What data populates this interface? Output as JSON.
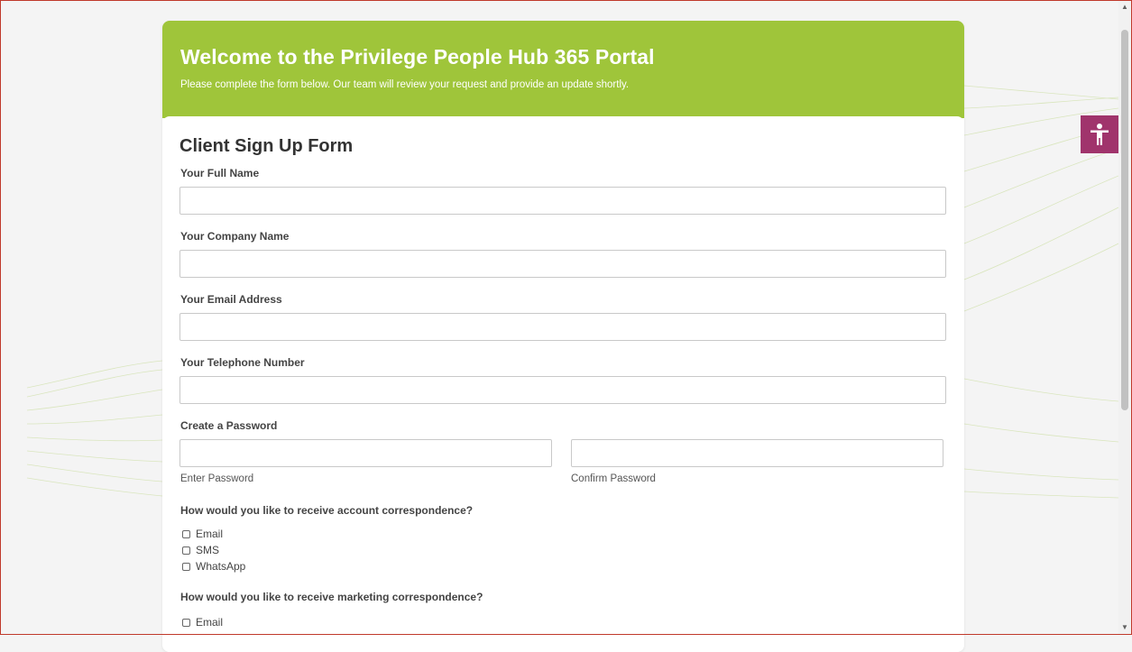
{
  "banner": {
    "title": "Welcome to the Privilege People Hub 365 Portal",
    "subtitle": "Please complete the form below. Our team will review your request and provide an update shortly."
  },
  "form": {
    "title": "Client Sign Up Form",
    "fields": {
      "full_name": {
        "label": "Your Full Name",
        "value": ""
      },
      "company": {
        "label": "Your Company Name",
        "value": ""
      },
      "email": {
        "label": "Your Email Address",
        "value": ""
      },
      "telephone": {
        "label": "Your Telephone Number",
        "value": ""
      }
    },
    "password": {
      "label": "Create a Password",
      "enter_sublabel": "Enter Password",
      "confirm_sublabel": "Confirm Password"
    },
    "account_correspondence": {
      "question": "How would you like to receive account correspondence?",
      "options": [
        "Email",
        "SMS",
        "WhatsApp"
      ]
    },
    "marketing_correspondence": {
      "question": "How would you like to receive marketing correspondence?",
      "options": [
        "Email"
      ]
    }
  },
  "accessibility": {
    "icon": "accessibility-person-icon",
    "color": "#a0346c"
  },
  "colors": {
    "banner": "#9fc53a",
    "border": "#c0392b"
  }
}
